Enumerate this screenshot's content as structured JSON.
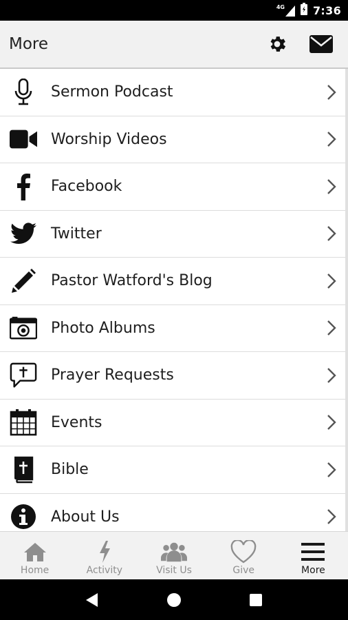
{
  "status_bar": {
    "network": "4G",
    "time": "7:36"
  },
  "app_bar": {
    "title": "More",
    "actions": [
      "settings-icon",
      "mail-icon"
    ]
  },
  "menu_items": [
    {
      "label": "Sermon Podcast",
      "icon": "microphone-icon"
    },
    {
      "label": "Worship Videos",
      "icon": "video-camera-icon"
    },
    {
      "label": "Facebook",
      "icon": "facebook-icon"
    },
    {
      "label": "Twitter",
      "icon": "twitter-icon"
    },
    {
      "label": "Pastor Watford's Blog",
      "icon": "pencil-icon"
    },
    {
      "label": "Photo Albums",
      "icon": "camera-icon"
    },
    {
      "label": "Prayer Requests",
      "icon": "speech-cross-icon"
    },
    {
      "label": "Events",
      "icon": "calendar-icon"
    },
    {
      "label": "Bible",
      "icon": "bible-icon"
    },
    {
      "label": "About Us",
      "icon": "info-icon"
    }
  ],
  "tabs": [
    {
      "label": "Home",
      "icon": "home-icon",
      "active": false
    },
    {
      "label": "Activity",
      "icon": "lightning-icon",
      "active": false
    },
    {
      "label": "Visit Us",
      "icon": "group-icon",
      "active": false
    },
    {
      "label": "Give",
      "icon": "heart-icon",
      "active": false
    },
    {
      "label": "More",
      "icon": "hamburger-icon",
      "active": true
    }
  ],
  "colors": {
    "app_bar_bg": "#f1f1f1",
    "icon": "#1a1a1a",
    "tab_inactive": "#8e8e8e",
    "tab_active": "#1a1a1a"
  }
}
